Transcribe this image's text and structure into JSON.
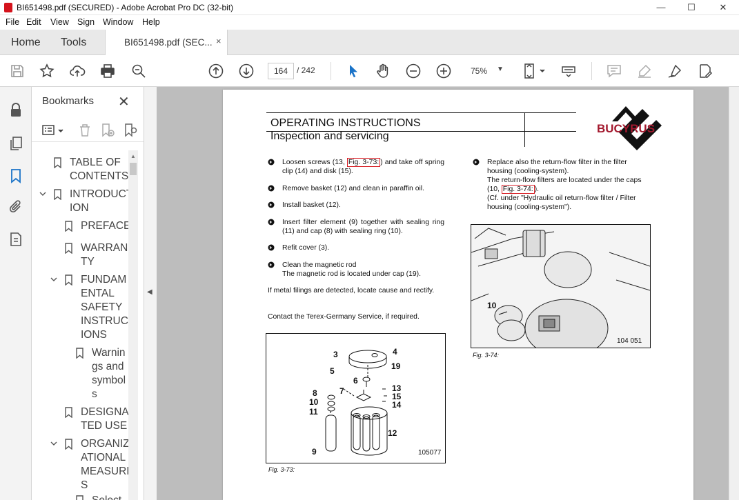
{
  "window": {
    "title": "BI651498.pdf (SECURED) - Adobe Acrobat Pro DC (32-bit)",
    "minimize": "—",
    "maximize": "☐",
    "close": "✕"
  },
  "menu": [
    "File",
    "Edit",
    "View",
    "Sign",
    "Window",
    "Help"
  ],
  "tabs": {
    "home": "Home",
    "tools": "Tools",
    "document": "BI651498.pdf (SEC...",
    "close": "×"
  },
  "toolbar": {
    "current_page": "164",
    "total_pages": "/ 242",
    "zoom": "75%",
    "zoom_caret": "▼"
  },
  "bookmarks": {
    "title": "Bookmarks",
    "close": "✕",
    "items": [
      {
        "label": "TABLE OF\nCONTENTS",
        "expander": "none"
      },
      {
        "label": "INTRODUCT\nION",
        "expander": "open"
      },
      {
        "label": "PREFACE",
        "expander": "none"
      },
      {
        "label": "WARRAN\nTY",
        "expander": "none"
      },
      {
        "label": "FUNDAM\nENTAL\nSAFETY\nINSTRUCT\nIONS",
        "expander": "open"
      },
      {
        "label": "Warnin\ngs and\nsymbol\ns",
        "expander": "none"
      },
      {
        "label": "DESIGNA\nTED USE",
        "expander": "none"
      },
      {
        "label": "ORGANIZ\nATIONAL\nMEASURE\nS",
        "expander": "open"
      },
      {
        "label": "Select",
        "expander": "none"
      }
    ]
  },
  "document": {
    "header": {
      "line1": "OPERATING INSTRUCTIONS",
      "line2": "Inspection and servicing",
      "logo_text": "BUCYRUS",
      "logo_color": "#a3192e"
    },
    "left_column": {
      "bullet1_pre": "Loosen screws (13, ",
      "bullet1_link": "Fig. 3-73:",
      "bullet1_post": ") and take off spring clip (14) and disk (15).",
      "bullet2": "Remove basket (12) and clean in paraffin oil.",
      "bullet3": "Install basket (12).",
      "bullet4": "Insert filter element (9) together with sealing ring (11) and cap (8) with sealing ring (10).",
      "bullet5": "Refit cover (3).",
      "bullet6_line1": "Clean the magnetic rod",
      "bullet6_line2": "The magnetic rod is located under cap (19).",
      "para1": "If metal filings are detected, locate cause and rectify.",
      "para2": "Contact the Terex-Germany Service, if required."
    },
    "right_column": {
      "bullet1_line1": "Replace also the return-flow filter in the filter housing (cooling-system).",
      "bullet1_line2_pre": "The return-flow filters are located under the caps (10, ",
      "bullet1_link": "Fig. 3-74:",
      "bullet1_line2_post": ").",
      "bullet1_line3": " (Cf. under \"Hydraulic oil return-flow filter / Filter housing  (cooling-system\")."
    },
    "figure_73": {
      "number": "105077",
      "caption": "Fig. 3-73:",
      "labels": [
        "3",
        "4",
        "19",
        "5",
        "6",
        "7",
        "13",
        "15",
        "14",
        "8",
        "10",
        "11",
        "12",
        "9"
      ]
    },
    "figure_74": {
      "number": "104 051",
      "caption": "Fig. 3-74:",
      "labels": [
        "10"
      ]
    },
    "link_color": "#d81f26"
  }
}
